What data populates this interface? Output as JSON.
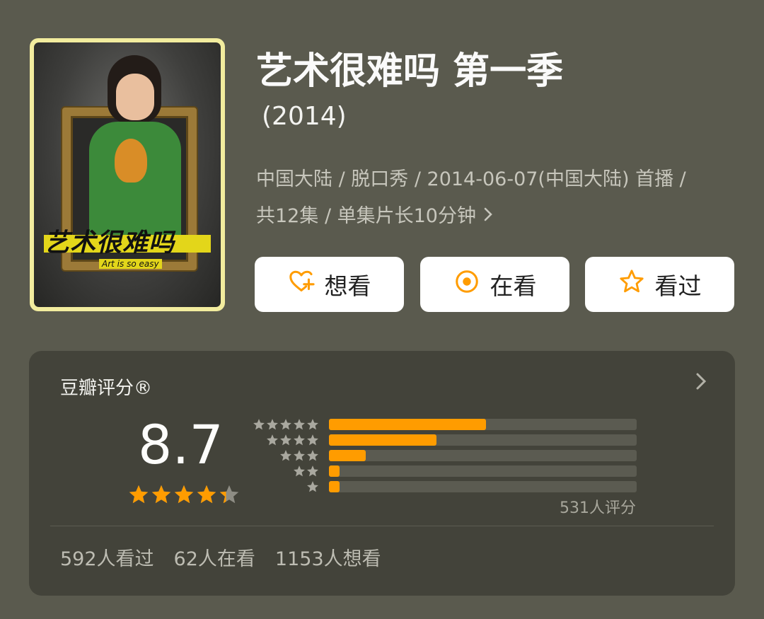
{
  "show": {
    "title": "艺术很难吗 第一季",
    "year": "(2014)",
    "meta_line1": "中国大陆 / 脱口秀 / 2014-06-07(中国大陆) 首播 /",
    "meta_line2": "共12集 / 单集片长10分钟"
  },
  "poster": {
    "title_text": "艺术很难吗",
    "subtitle_text": "Art is so easy"
  },
  "actions": {
    "want_label": "想看",
    "watching_label": "在看",
    "watched_label": "看过"
  },
  "rating": {
    "label": "豆瓣评分®",
    "score": "8.7",
    "stars_value": 4.35,
    "distribution": [
      {
        "stars": 5,
        "fraction": 0.51
      },
      {
        "stars": 4,
        "fraction": 0.35
      },
      {
        "stars": 3,
        "fraction": 0.12
      },
      {
        "stars": 2,
        "fraction": 0.03
      },
      {
        "stars": 1,
        "fraction": 0.03
      }
    ],
    "count_text": "531人评分"
  },
  "stats": {
    "watched": "592人看过",
    "watching": "62人在看",
    "want": "1153人想看"
  },
  "colors": {
    "accent": "#ff9c00",
    "star_gray": "#a9a89f",
    "background": "#5a5a4e",
    "card": "#43433a"
  }
}
